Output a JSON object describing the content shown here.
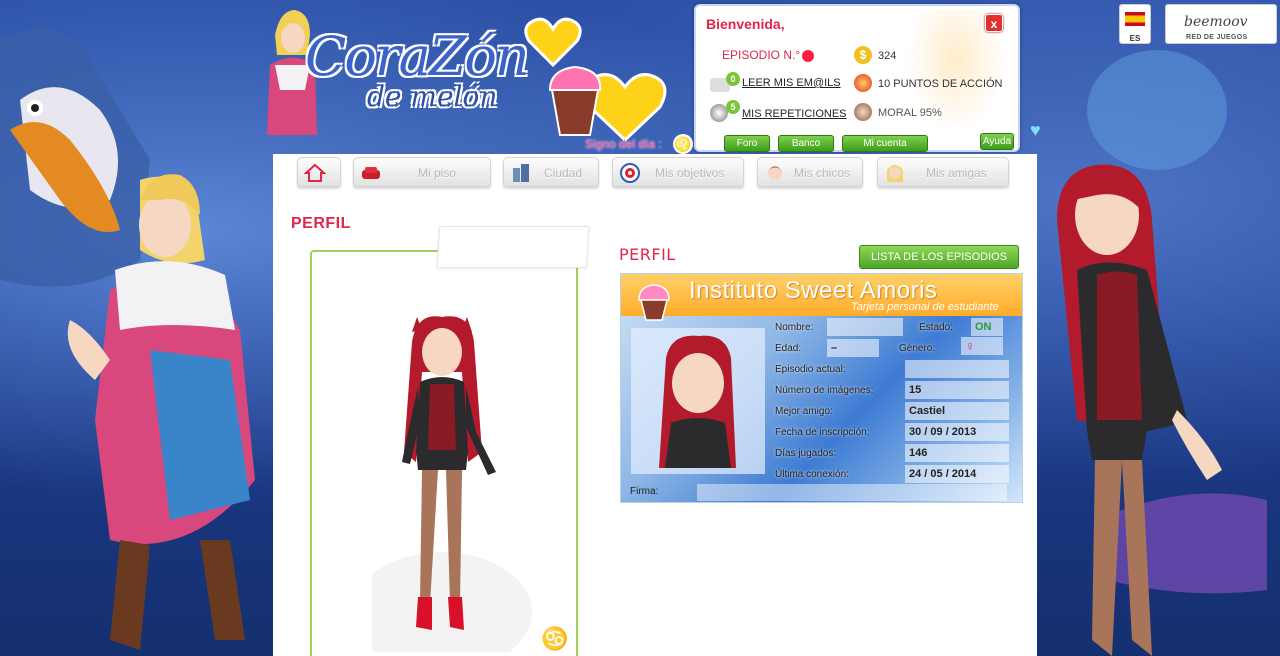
{
  "header": {
    "logo_main": "CoraZón",
    "logo_sub": "de melón",
    "signo_label": "Signo del día :"
  },
  "user_panel": {
    "welcome": "Bienvenida,",
    "close": "x",
    "episode_label": "EPISODIO N.°",
    "coins": "324",
    "mail_count": "0",
    "mail_link": "LEER MIS EM@ILS",
    "action_points": "10 PUNTOS DE ACCIÓN",
    "replay_count": "5",
    "replay_link": "MIS REPETICIONES",
    "morale": "MORAL 95%",
    "buttons": [
      "Foro",
      "Banco",
      "Mi cuenta",
      "Ayuda"
    ]
  },
  "top_right": {
    "lang": "ES",
    "network_logo": "beemoov",
    "network_sub": "RED DE JUEGOS"
  },
  "nav": {
    "items": [
      "",
      "Mi piso",
      "Ciudad",
      "Mis objetivos",
      "Mis chicos",
      "Mis amigas"
    ]
  },
  "page_title": "PERFIL",
  "profile": {
    "section_title": "PERFIL",
    "episodes_button": "Lista de los episodios",
    "card": {
      "title": "Instituto Sweet Amoris",
      "subtitle": "Tarjeta personal de estudiante",
      "labels": {
        "nombre": "Nombre:",
        "estado": "Estado:",
        "edad": "Edad:",
        "genero": "Género:",
        "episodio": "Episodio actual:",
        "imagenes": "Número de imágenes:",
        "mejor": "Mejor amigo:",
        "inscripcion": "Fecha de inscripción:",
        "dias": "Días jugados:",
        "conexion": "Última conexión:",
        "firma": "Firma:"
      },
      "values": {
        "estado": "ON",
        "edad": "–",
        "genero": "♀",
        "imagenes": "15",
        "mejor": "Castiel",
        "inscripcion": "30 / 09 / 2013",
        "dias": "146",
        "conexion": "24 / 05 / 2014"
      }
    }
  },
  "colors": {
    "accent_pink": "#e0264a",
    "button_green": "#4ea52a",
    "background_blue": "#1d3c8e"
  },
  "icons": [
    "home-icon",
    "sofa-icon",
    "city-icon",
    "target-icon",
    "boy-icon",
    "girl-icon",
    "coin-icon",
    "mail-icon",
    "fire-icon",
    "replay-icon",
    "cancer-zodiac-icon",
    "leo-zodiac-icon"
  ]
}
